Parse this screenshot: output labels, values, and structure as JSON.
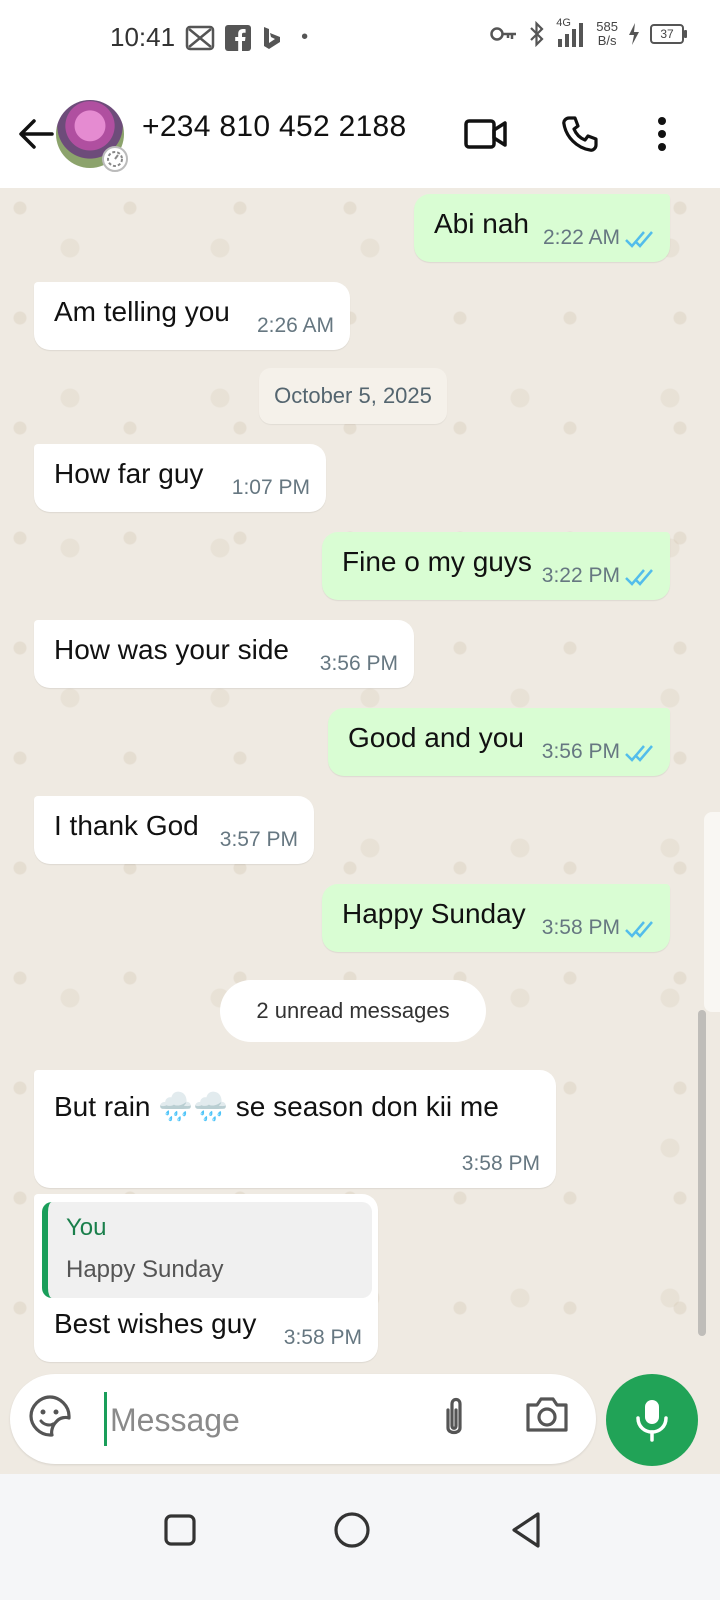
{
  "status_bar": {
    "time": "10:41",
    "net_type": "4G",
    "speed_value": "585",
    "speed_unit": "B/s",
    "battery": "37"
  },
  "header": {
    "contact": "+234 810 452 2188",
    "icons": [
      "back-arrow-icon",
      "video-call-icon",
      "phone-icon",
      "more-vertical-icon"
    ]
  },
  "messages": [
    {
      "direction": "out",
      "text": "Abi nah",
      "time": "2:22 AM",
      "read": true
    },
    {
      "direction": "in",
      "text": "Am telling you",
      "time": "2:26 AM"
    },
    {
      "direction": "in",
      "text": "How far guy",
      "time": "1:07 PM"
    },
    {
      "direction": "out",
      "text": "Fine o my guys",
      "time": "3:22 PM",
      "read": true
    },
    {
      "direction": "in",
      "text": "How was your side",
      "time": "3:56 PM"
    },
    {
      "direction": "out",
      "text": "Good and you",
      "time": "3:56 PM",
      "read": true
    },
    {
      "direction": "in",
      "text": "I thank God",
      "time": "3:57 PM"
    },
    {
      "direction": "out",
      "text": "Happy Sunday",
      "time": "3:58 PM",
      "read": true
    },
    {
      "direction": "in",
      "text": "But rain 🌧️🌧️ se season don kii me",
      "time": "3:58 PM"
    },
    {
      "direction": "in",
      "text": "Best wishes guy",
      "time": "3:58 PM",
      "quote": {
        "author": "You",
        "text": "Happy Sunday"
      }
    }
  ],
  "date_divider": "October 5, 2025",
  "unread_divider": "2 unread messages",
  "composer": {
    "placeholder": "Message",
    "value": ""
  },
  "colors": {
    "accent": "#21a357",
    "outgoing_bubble": "#d9fdd3",
    "incoming_bubble": "#ffffff",
    "read_ticks": "#53bdeb"
  }
}
